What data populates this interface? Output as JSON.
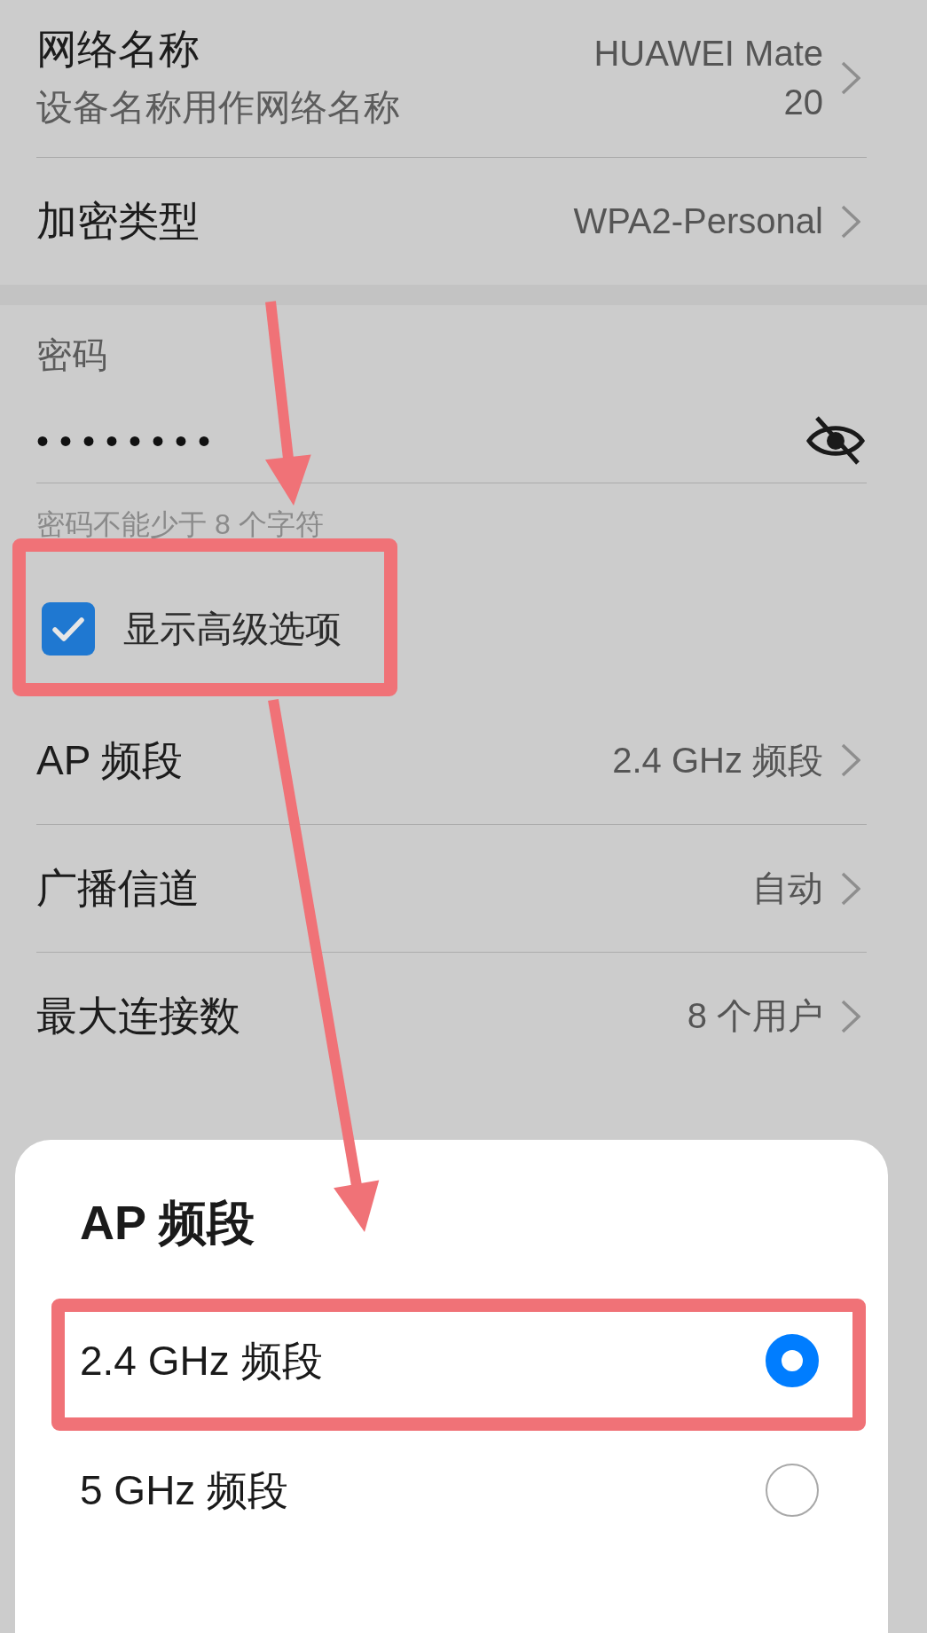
{
  "settings": [
    {
      "label": "网络名称",
      "subtitle": "设备名称用作网络名称",
      "value": "HUAWEI Mate 20"
    },
    {
      "label": "加密类型",
      "value": "WPA2-Personal"
    }
  ],
  "password": {
    "label": "密码",
    "value": "••••••••",
    "visible": false,
    "hint": "密码不能少于 8 个字符"
  },
  "show_advanced": {
    "label": "显示高级选项",
    "checked": true,
    "highlighted": true
  },
  "advanced": [
    {
      "label": "AP 频段",
      "value": "2.4 GHz 频段"
    },
    {
      "label": "广播信道",
      "value": "自动"
    },
    {
      "label": "最大连接数",
      "value": "8 个用户"
    }
  ],
  "dialog": {
    "title": "AP 频段",
    "options": [
      {
        "label": "2.4 GHz 频段",
        "selected": true,
        "highlighted": true
      },
      {
        "label": "5 GHz 频段",
        "selected": false,
        "highlighted": false
      }
    ]
  }
}
